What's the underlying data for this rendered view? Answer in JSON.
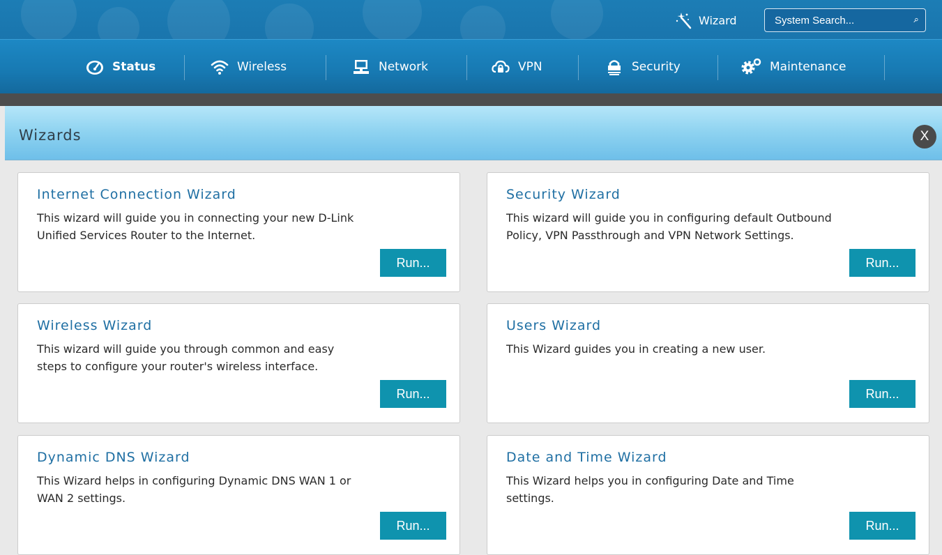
{
  "header": {
    "wizard_label": "Wizard",
    "search_placeholder": "System Search..."
  },
  "nav": {
    "items": [
      {
        "label": "Status",
        "icon": "gauge-icon",
        "active": true
      },
      {
        "label": "Wireless",
        "icon": "wifi-icon"
      },
      {
        "label": "Network",
        "icon": "computer-icon"
      },
      {
        "label": "VPN",
        "icon": "cloud-lock-icon"
      },
      {
        "label": "Security",
        "icon": "lock-icon"
      },
      {
        "label": "Maintenance",
        "icon": "gears-icon"
      }
    ]
  },
  "modal": {
    "title": "Wizards",
    "close_label": "X",
    "cards": [
      {
        "title": "Internet Connection Wizard",
        "description": "This wizard will guide you in connecting your new D-Link Unified Services Router to the Internet.",
        "button": "Run..."
      },
      {
        "title": "Security Wizard",
        "description": "This wizard will guide you in configuring default Outbound Policy, VPN Passthrough and VPN Network Settings.",
        "button": "Run..."
      },
      {
        "title": "Wireless Wizard",
        "description": "This wizard will guide you through common and easy steps to configure your router's wireless interface.",
        "button": "Run..."
      },
      {
        "title": "Users Wizard",
        "description": "This Wizard guides you in creating a new user.",
        "button": "Run..."
      },
      {
        "title": "Dynamic DNS Wizard",
        "description": "This Wizard helps in configuring Dynamic DNS WAN 1 or WAN 2 settings.",
        "button": "Run..."
      },
      {
        "title": "Date and Time Wizard",
        "description": "This Wizard helps you in configuring Date and Time settings.",
        "button": "Run..."
      }
    ]
  }
}
